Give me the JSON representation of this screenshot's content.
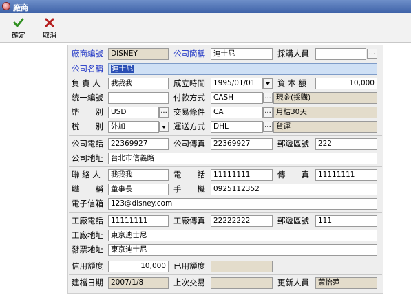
{
  "window": {
    "title": "廠商"
  },
  "toolbar": {
    "confirm": "確定",
    "cancel": "取消"
  },
  "labels": {
    "vendor_code": "廠商編號",
    "company_short": "公司簡稱",
    "buyer": "採購人員",
    "company_name": "公司名稱",
    "owner": "負 責 人",
    "founded": "成立時間",
    "capital": "資 本 額",
    "tax_id": "統一編號",
    "payment": "付款方式",
    "currency": "幣　　別",
    "trade_terms": "交易條件",
    "tax": "稅　　別",
    "shipping": "運送方式",
    "phone": "公司電話",
    "fax": "公司傳真",
    "zip": "郵遞區號",
    "address": "公司地址",
    "contact": "聯 絡 人",
    "contact_phone": "電　　話",
    "contact_fax": "傳　　真",
    "title": "職　　稱",
    "mobile": "手　　機",
    "email": "電子信箱",
    "factory_phone": "工廠電話",
    "factory_fax": "工廠傳真",
    "factory_zip": "郵遞區號",
    "factory_address": "工廠地址",
    "invoice_address": "發票地址",
    "credit_limit": "信用額度",
    "credit_used": "已用額度",
    "created": "建檔日期",
    "last_trade": "上次交易",
    "updated_by": "更新人員"
  },
  "values": {
    "vendor_code": "DISNEY",
    "company_short": "迪士尼",
    "buyer": "",
    "company_name": "迪士尼",
    "owner": "我我我",
    "founded": "1995/01/01",
    "capital": "10,000",
    "tax_id": "",
    "payment_code": "CASH",
    "payment_desc": "現金(採購)",
    "currency": "USD",
    "trade_code": "CA",
    "trade_desc": "月結30天",
    "tax": "外加",
    "ship_code": "DHL",
    "ship_desc": "貨運",
    "phone": "22369927",
    "fax": "22369927",
    "zip": "222",
    "address": "台北市信義路",
    "contact": "我我我",
    "contact_phone": "11111111",
    "contact_fax": "11111111",
    "title": "董事長",
    "mobile": "0925112352",
    "email": "123@disney.com",
    "factory_phone": "11111111",
    "factory_fax": "22222222",
    "factory_zip": "111",
    "factory_address": "東京迪士尼",
    "invoice_address": "東京迪士尼",
    "credit_limit": "10,000",
    "credit_used": "",
    "created": "2007/1/8",
    "last_trade": "",
    "updated_by": "蕭怡萍"
  },
  "lookup_button": "..."
}
